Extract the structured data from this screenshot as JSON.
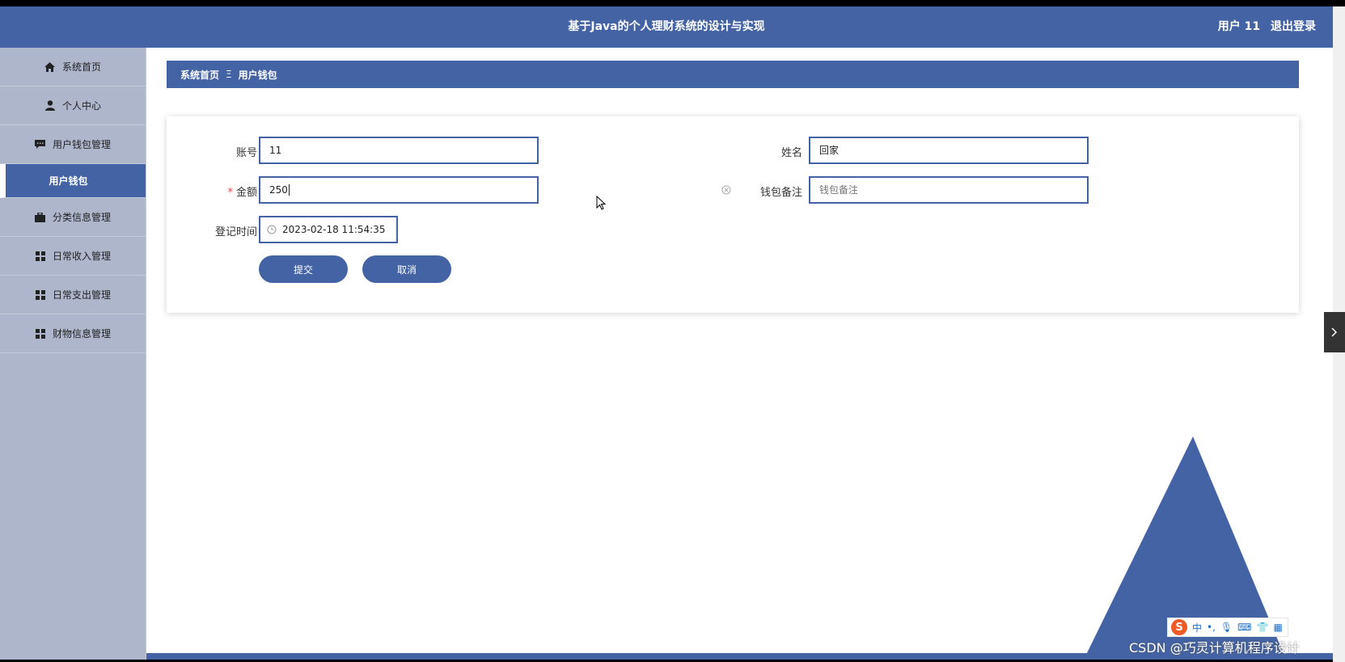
{
  "header": {
    "title": "基于Java的个人理财系统的设计与实现",
    "user": "用户 11",
    "logout": "退出登录"
  },
  "sidebar": {
    "items": [
      {
        "label": "系统首页",
        "icon": "home-icon"
      },
      {
        "label": "个人中心",
        "icon": "person-icon"
      },
      {
        "label": "用户钱包管理",
        "icon": "chat-icon"
      },
      {
        "label": "用户钱包",
        "icon": ""
      },
      {
        "label": "分类信息管理",
        "icon": "briefcase-icon"
      },
      {
        "label": "日常收入管理",
        "icon": "grid-icon"
      },
      {
        "label": "日常支出管理",
        "icon": "grid-icon"
      },
      {
        "label": "财物信息管理",
        "icon": "grid-icon"
      }
    ]
  },
  "breadcrumb": {
    "home": "系统首页",
    "separator": "Ξ",
    "current": "用户钱包"
  },
  "form": {
    "account_label": "账号",
    "account_value": "11",
    "name_label": "姓名",
    "name_value": "回家",
    "amount_required": "*",
    "amount_label": "金额",
    "amount_value": "250",
    "note_label": "钱包备注",
    "note_placeholder": "钱包备注",
    "time_label": "登记时间",
    "time_value": "2023-02-18 11:54:35",
    "submit": "提交",
    "cancel": "取消"
  },
  "overlay": {
    "ime_char": "中",
    "ime_logo": "S",
    "watermark": "CSDN @巧灵计算机程序设计"
  },
  "colors": {
    "primary": "#4363a4",
    "sidebar_bg": "#aeb6cc",
    "required": "#e04b4b"
  }
}
